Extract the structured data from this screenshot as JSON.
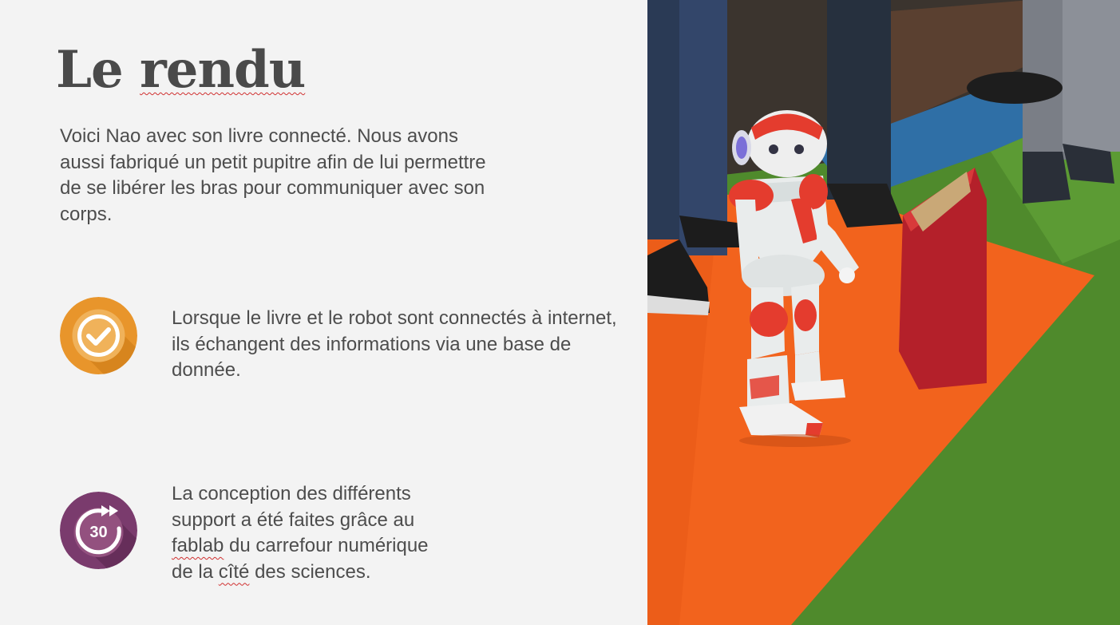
{
  "slide": {
    "title_part1": "Le ",
    "title_part2": "rendu",
    "intro": "Voici Nao avec son livre connecté. Nous avons aussi fabriqué un petit pupitre afin de lui permettre de se libérer les bras pour communiquer avec son corps.",
    "row1": {
      "icon": "check-circle-icon",
      "text": "Lorsque le livre et le robot sont connectés à internet, ils échangent des informations via une base de donnée."
    },
    "row2": {
      "icon": "forward-30-icon",
      "icon_label": "30",
      "line1": "La conception des différents",
      "line2": "support a été faites grâce au",
      "line3_word": "fablab",
      "line3_rest": " du carrefour numérique",
      "line4_start": "de la ",
      "line4_word": "cîté",
      "line4_rest": " des sciences."
    },
    "photo": {
      "subject": "nao-robot-photo"
    }
  },
  "colors": {
    "background": "#f3f3f3",
    "text": "#4d4d4d",
    "orange_icon": "#e8952b",
    "purple_icon": "#7a3b6d",
    "carpet_orange": "#f2631d",
    "carpet_green": "#4f8a2c"
  }
}
